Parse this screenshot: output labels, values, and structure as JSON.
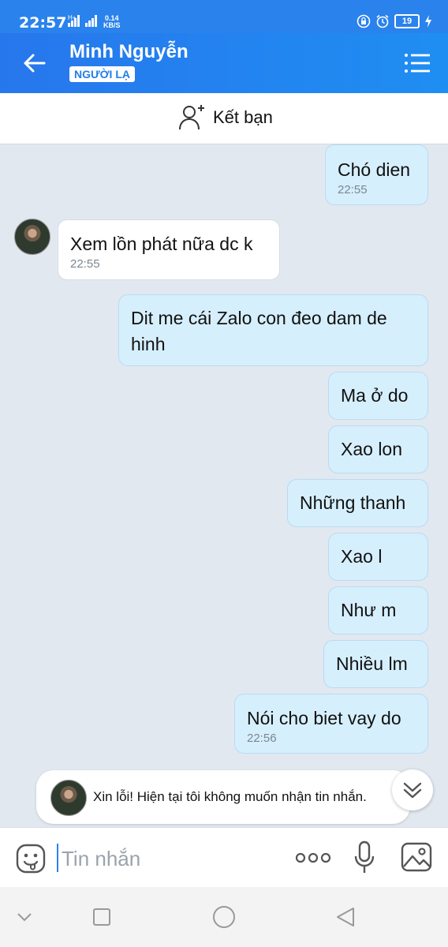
{
  "status_bar": {
    "time": "22:57",
    "network": "H+",
    "speed_value": "0.14",
    "speed_unit": "KB/S",
    "battery": "19"
  },
  "header": {
    "contact_name": "Minh Nguyễn",
    "badge": "NGƯỜI LẠ"
  },
  "add_friend": {
    "label": "Kết bạn"
  },
  "messages": [
    {
      "dir": "out",
      "text": "Chó dien",
      "time": "22:55"
    },
    {
      "dir": "in",
      "text": "Xem lồn phát nữa dc k",
      "time": "22:55"
    },
    {
      "dir": "out",
      "text": "Dit me cái Zalo con đeo dam de hinh",
      "time": ""
    },
    {
      "dir": "out",
      "text": "Ma ở do",
      "time": ""
    },
    {
      "dir": "out",
      "text": "Xao lon",
      "time": ""
    },
    {
      "dir": "out",
      "text": "Những thanh",
      "time": ""
    },
    {
      "dir": "out",
      "text": "Xao l",
      "time": ""
    },
    {
      "dir": "out",
      "text": "Như m",
      "time": ""
    },
    {
      "dir": "out",
      "text": "Nhiều lm",
      "time": ""
    },
    {
      "dir": "out",
      "text": "Nói cho biet vay do",
      "time": "22:56"
    }
  ],
  "notice": {
    "text": "Xin lỗi! Hiện tại tôi không muốn nhận tin nhắn."
  },
  "composer": {
    "placeholder": "Tin nhắn"
  },
  "icons": [
    "back-arrow-icon",
    "menu-icon",
    "add-friend-icon",
    "chevron-double-down-icon",
    "emoji-icon",
    "more-icon",
    "microphone-icon",
    "image-icon"
  ]
}
